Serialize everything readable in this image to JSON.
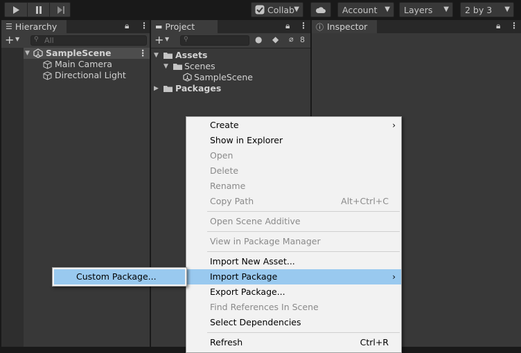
{
  "toolbar": {
    "play_icon": "play-icon",
    "pause_icon": "pause-icon",
    "step_icon": "step-icon",
    "collab_label": "Collab",
    "account_label": "Account",
    "layers_label": "Layers",
    "layout_label": "2 by 3"
  },
  "hierarchy": {
    "tab_label": "Hierarchy",
    "search_placeholder": "All",
    "scene_name": "SampleScene",
    "items": [
      "Main Camera",
      "Directional Light"
    ]
  },
  "project": {
    "tab_label": "Project",
    "eye_count": "8",
    "tree": {
      "assets": "Assets",
      "scenes": "Scenes",
      "scene_file": "SampleScene",
      "packages": "Packages"
    }
  },
  "inspector": {
    "tab_label": "Inspector"
  },
  "context_menu": {
    "items": [
      {
        "label": "Create"
      },
      {
        "label": "Show in Explorer"
      },
      {
        "label": "Open"
      },
      {
        "label": "Delete"
      },
      {
        "label": "Rename"
      },
      {
        "label": "Copy Path",
        "shortcut": "Alt+Ctrl+C"
      },
      {
        "label": "Open Scene Additive"
      },
      {
        "label": "View in Package Manager"
      },
      {
        "label": "Import New Asset..."
      },
      {
        "label": "Import Package"
      },
      {
        "label": "Export Package..."
      },
      {
        "label": "Find References In Scene"
      },
      {
        "label": "Select Dependencies"
      },
      {
        "label": "Refresh",
        "shortcut": "Ctrl+R"
      }
    ]
  },
  "submenu": {
    "items": [
      {
        "label": "Custom Package..."
      }
    ]
  },
  "colors": {
    "highlight": "#99c9ef",
    "panel": "#383838",
    "menu_bg": "#f2f2f2"
  }
}
